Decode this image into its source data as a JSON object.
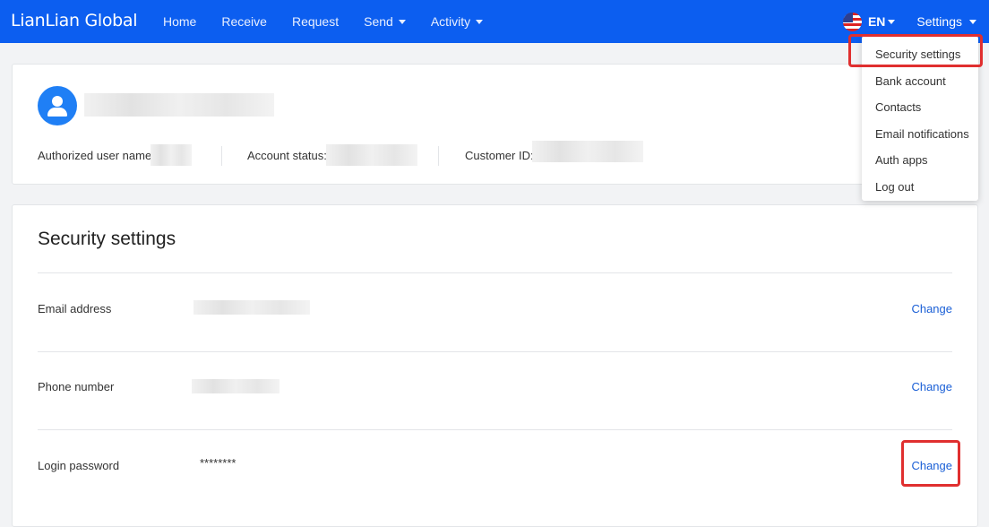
{
  "header": {
    "logo": "LianLian Global",
    "nav": [
      {
        "label": "Home",
        "has_caret": false
      },
      {
        "label": "Receive",
        "has_caret": false
      },
      {
        "label": "Request",
        "has_caret": false
      },
      {
        "label": "Send",
        "has_caret": true
      },
      {
        "label": "Activity",
        "has_caret": true
      }
    ],
    "language": "EN",
    "settings_label": "Settings",
    "colors": {
      "bar": "#0c5ef0",
      "highlight": "#e02f2f",
      "link": "#1a5fd6"
    }
  },
  "settings_menu": {
    "items": [
      "Security settings",
      "Bank account",
      "Contacts",
      "Email notifications",
      "Auth apps",
      "Log out"
    ]
  },
  "profile": {
    "authorized_user_label": "Authorized user name",
    "account_status_label": "Account status:",
    "customer_id_label": "Customer ID:"
  },
  "security": {
    "title": "Security settings",
    "rows": [
      {
        "label": "Email address",
        "value": "",
        "action": "Change"
      },
      {
        "label": "Phone number",
        "value": "",
        "action": "Change"
      },
      {
        "label": "Login password",
        "value": "********",
        "action": "Change"
      }
    ]
  }
}
